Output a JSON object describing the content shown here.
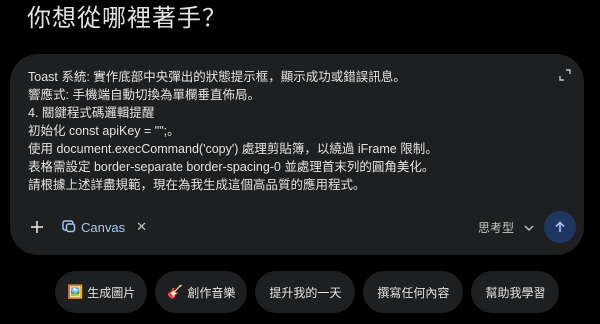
{
  "heading": "你想從哪裡著手？",
  "composer": {
    "prompt_lines": [
      "Toast 系統: 實作底部中央彈出的狀態提示框，顯示成功或錯誤訊息。",
      "響應式: 手機端自動切換為單欄垂直佈局。",
      "4. 關鍵程式碼邏輯提醒",
      "初始化 const apiKey = \"\";。",
      "使用 document.execCommand('copy') 處理剪貼簿，以繞過 iFrame 限制。",
      "表格需設定 border-separate border-spacing-0 並處理首末列的圓角美化。",
      "請根據上述詳盡規範，現在為我生成這個高品質的應用程式。"
    ],
    "tool_chip": {
      "label": "Canvas",
      "icon": "canvas-icon"
    },
    "model_label": "思考型",
    "accent_color": "#a8c7fa",
    "send_button_color": "#1f3760"
  },
  "suggestions": [
    {
      "emoji": "🖼️",
      "label": "生成圖片"
    },
    {
      "emoji": "🎸",
      "label": "創作音樂"
    },
    {
      "emoji": "",
      "label": "提升我的一天"
    },
    {
      "emoji": "",
      "label": "撰寫任何內容"
    },
    {
      "emoji": "",
      "label": "幫助我學習"
    }
  ]
}
